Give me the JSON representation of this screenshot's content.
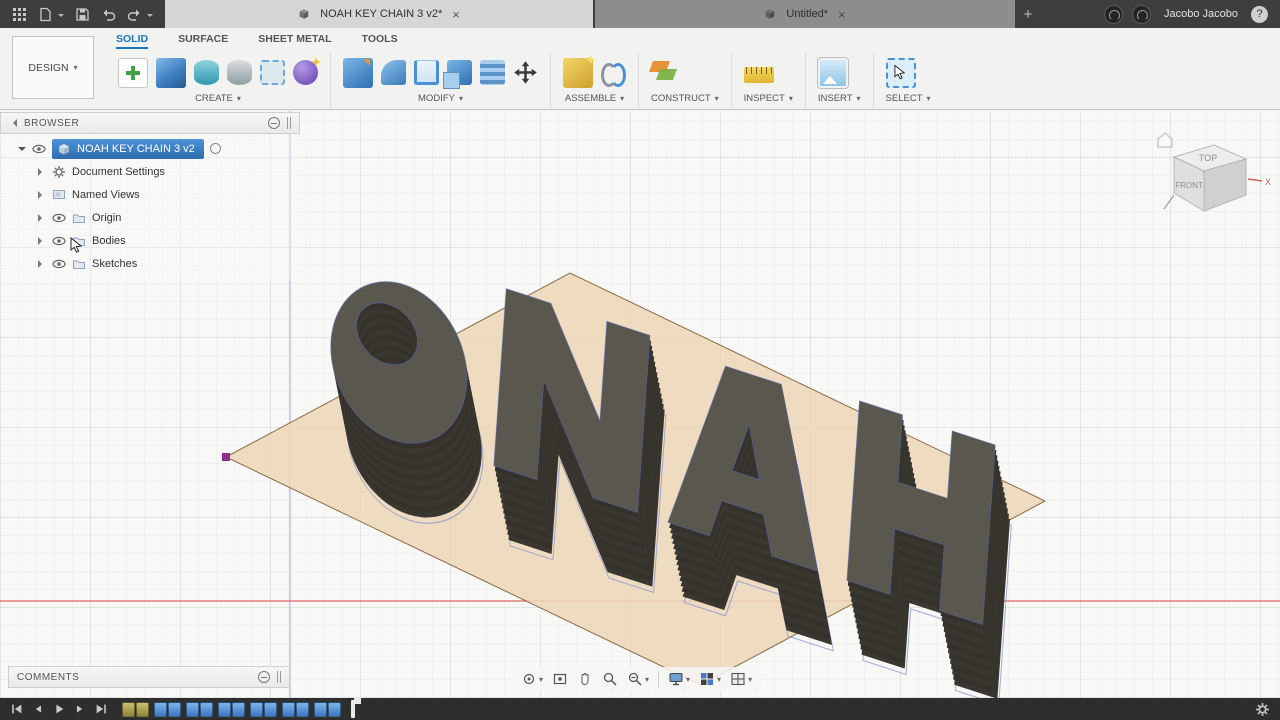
{
  "ui": {
    "caret": "▾",
    "close": "×",
    "plus": "+"
  },
  "titlebar": {
    "tabs": [
      {
        "label": "NOAH KEY CHAIN 3 v2*"
      },
      {
        "label": "Untitled*"
      }
    ],
    "user_name": "Jacobo Jacobo",
    "help_label": "?"
  },
  "ribbon": {
    "design_label": "DESIGN",
    "tabs": [
      {
        "label": "SOLID",
        "active": true
      },
      {
        "label": "SURFACE",
        "active": false
      },
      {
        "label": "SHEET METAL",
        "active": false
      },
      {
        "label": "TOOLS",
        "active": false
      }
    ],
    "groups": [
      {
        "label": "CREATE"
      },
      {
        "label": "MODIFY"
      },
      {
        "label": "ASSEMBLE"
      },
      {
        "label": "CONSTRUCT"
      },
      {
        "label": "INSPECT"
      },
      {
        "label": "INSERT"
      },
      {
        "label": "SELECT"
      }
    ]
  },
  "browser": {
    "title": "BROWSER",
    "root_label": "NOAH KEY CHAIN 3 v2",
    "items": [
      {
        "label": "Document Settings",
        "icon": "gear"
      },
      {
        "label": "Named Views",
        "icon": "views"
      },
      {
        "label": "Origin",
        "icon": "folder"
      },
      {
        "label": "Bodies",
        "icon": "folder"
      },
      {
        "label": "Sketches",
        "icon": "folder"
      }
    ]
  },
  "comments": {
    "title": "COMMENTS"
  },
  "viewcube": {
    "top": "TOP",
    "front": "FRONT",
    "axis_x": "X"
  },
  "viewport": {
    "model": {
      "text": "NOAH",
      "style": "mirrored-extruded-letters",
      "top_color": "#5a574e",
      "side_color": "#34322b",
      "side_color_alt": "#3a3730",
      "edge_color": "rgba(85,105,190,0.55)",
      "plane_color": "rgba(236,214,182,0.85)",
      "plane_edge_color": "#8a6a48",
      "sketch_line_color": "#8593d2",
      "extrusion_steps": 14
    },
    "axes": {
      "x_color": "#e06666",
      "vertical_color": "#b0b6e6"
    },
    "origin_color": "#8b2f8b"
  },
  "timeline": {
    "features": [
      "sketch",
      "sketch",
      "extrude",
      "extrude",
      "extrude",
      "extrude",
      "extrude",
      "extrude",
      "extrude",
      "extrude",
      "extrude",
      "extrude",
      "extrude",
      "extrude"
    ]
  }
}
